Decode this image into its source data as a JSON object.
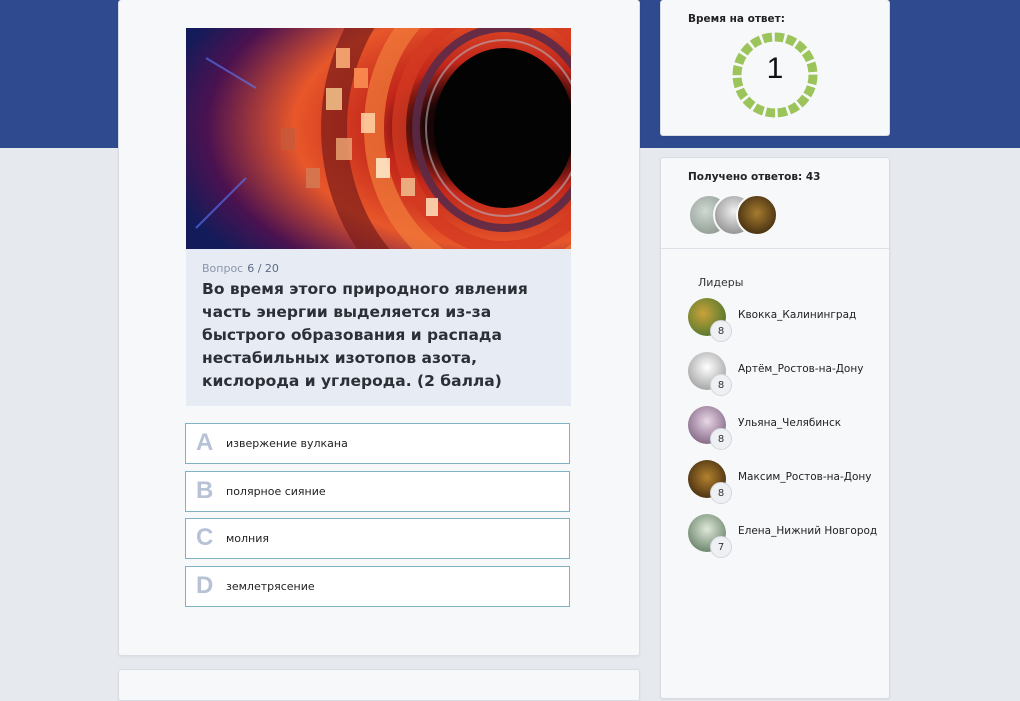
{
  "question": {
    "label": "Вопрос",
    "number": "6 / 20",
    "text": "Во время этого природного явления часть энергии выделяется из-за быстрого образования и распада нестабильных изотопов азота, кислорода и углерода. (2 балла)"
  },
  "answers": [
    {
      "letter": "A",
      "text": "извержение вулкана"
    },
    {
      "letter": "B",
      "text": "полярное сияние"
    },
    {
      "letter": "C",
      "text": "молния"
    },
    {
      "letter": "D",
      "text": "землетрясение"
    }
  ],
  "timer": {
    "label": "Время на ответ:",
    "value": "1",
    "ring_color": "#9bc45a"
  },
  "responses": {
    "label": "Получено ответов: 43"
  },
  "leaders": {
    "title": "Лидеры",
    "items": [
      {
        "name": "Квокка_Калининград",
        "score": "8"
      },
      {
        "name": "Артём_Ростов-на-Дону",
        "score": "8"
      },
      {
        "name": "Ульяна_Челябинск",
        "score": "8"
      },
      {
        "name": "Максим_Ростов-на-Дону",
        "score": "8"
      },
      {
        "name": "Елена_Нижний Новгород",
        "score": "7"
      }
    ]
  },
  "colors": {
    "header_band": "#2f4a8e",
    "answer_border": "#7fb3c4",
    "question_bg": "#e7ebf3"
  }
}
